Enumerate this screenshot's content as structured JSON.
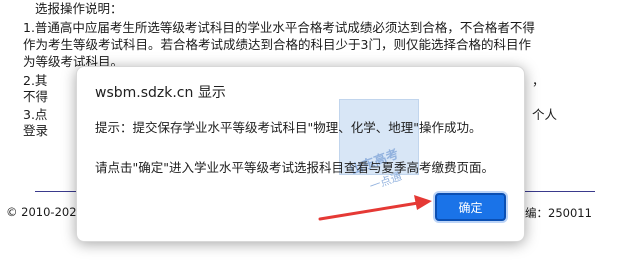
{
  "page": {
    "heading": "选报操作说明：",
    "rule1_line1": "1.普通高中应届考生所选等级考试科目的学业水平合格考试成绩必须达到合格，不合格者不得",
    "rule1_line2": "作为考生等级考试科目。若合格考试成绩达到合格的科目少于3门，则仅能选择合格的科目作",
    "rule1_line3": "为等级考试科目。",
    "rule2_start": "2.其",
    "rule2_cont": "不得",
    "rule2_end": "，",
    "rule3_start": "3.点",
    "rule3_end": "个人",
    "rule3_line2": "登录",
    "footer_left": "© 2010-202",
    "footer_right": "编：250011"
  },
  "dialog": {
    "title": "wsbm.sdzk.cn 显示",
    "message1": "提示：提交保存学业水平等级考试科目\"物理、化学、地理\"操作成功。",
    "message2": "请点击\"确定\"进入学业水平等级考试选报科目查看与夏季高考缴费页面。",
    "ok_label": "确定"
  },
  "watermark": {
    "text": "山东高考",
    "sub": "一点通"
  },
  "colors": {
    "button": "#1a73e8",
    "arrow": "#e53935",
    "divider": "#3a3a8c"
  }
}
